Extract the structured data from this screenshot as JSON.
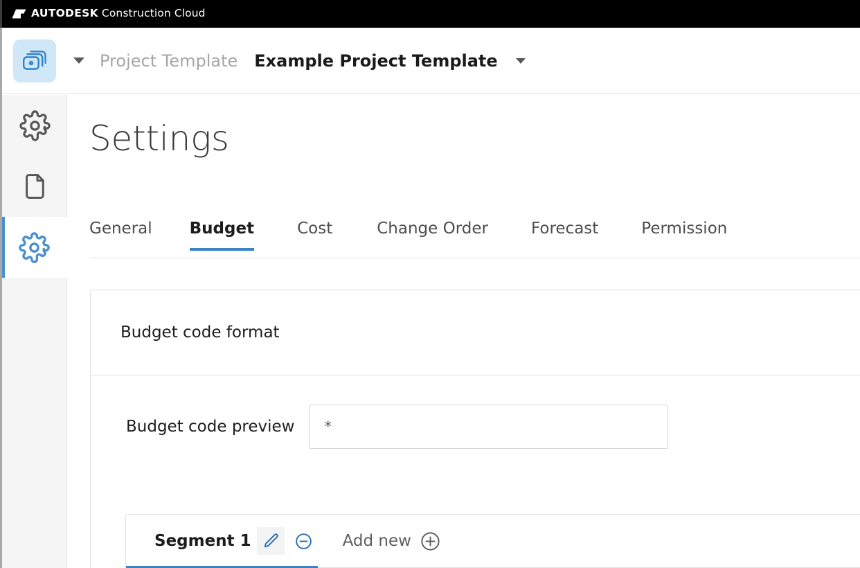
{
  "topbar": {
    "brand_bold": "AUTODESK",
    "brand_light": "Construction Cloud",
    "logo_icon": "autodesk-logo-icon",
    "background": "#000000"
  },
  "project_header": {
    "project_icon": "project-stack-icon",
    "project_icon_tile_color": "#cfe7f7",
    "breadcrumb_caret_icon": "caret-down-icon",
    "breadcrumb_label": "Project Template",
    "project_name": "Example Project Template",
    "project_switch_caret_icon": "caret-down-icon"
  },
  "sidebar": {
    "items": [
      {
        "icon": "gear-icon",
        "name": "settings-rail-item-1",
        "active": false
      },
      {
        "icon": "document-icon",
        "name": "document-rail-item",
        "active": false
      },
      {
        "icon": "gear-icon",
        "name": "settings-rail-item-active",
        "active": true
      }
    ],
    "active_accent": "#4a90cd",
    "background": "#f5f5f5"
  },
  "main": {
    "page_title": "Settings",
    "tabs": [
      {
        "label": "General",
        "active": false
      },
      {
        "label": "Budget",
        "active": true
      },
      {
        "label": "Cost",
        "active": false
      },
      {
        "label": "Change Order",
        "active": false
      },
      {
        "label": "Forecast",
        "active": false
      },
      {
        "label": "Permission",
        "active": false
      }
    ],
    "tab_accent": "#3a84c5"
  },
  "card": {
    "title": "Budget code format",
    "preview": {
      "label": "Budget code preview",
      "value": "*",
      "placeholder": ""
    },
    "segments": {
      "active_segment_label": "Segment 1",
      "edit_icon": "pencil-icon",
      "remove_icon": "minus-circle-icon",
      "add_new_label": "Add new",
      "add_new_icon": "plus-circle-icon",
      "icon_accent": "#2a6eb0",
      "add_new_color": "#5f5f5f",
      "active_underline": "#3a84c5"
    }
  }
}
